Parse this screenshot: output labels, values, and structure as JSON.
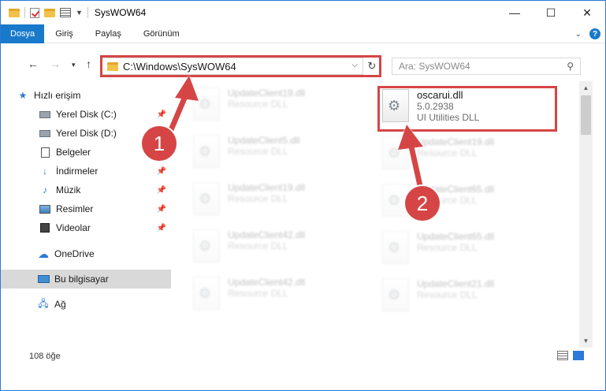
{
  "window": {
    "title": "SysWOW64",
    "controls": {
      "minimize": "—",
      "maximize": "☐",
      "close": "✕"
    }
  },
  "ribbon": {
    "tabs": [
      "Dosya",
      "Giriş",
      "Paylaş",
      "Görünüm"
    ],
    "active_tab": "Dosya"
  },
  "nav": {
    "address": "C:\\Windows\\SysWOW64",
    "search_placeholder": "Ara: SysWOW64"
  },
  "sidebar": {
    "items": [
      {
        "label": "Hızlı erişim",
        "icon": "star-icon",
        "pinned": false
      },
      {
        "label": "Yerel Disk (C:)",
        "icon": "drive-icon",
        "pinned": true
      },
      {
        "label": "Yerel Disk (D:)",
        "icon": "drive-icon",
        "pinned": false
      },
      {
        "label": "Belgeler",
        "icon": "documents-icon",
        "pinned": false
      },
      {
        "label": "İndirmeler",
        "icon": "download-icon",
        "pinned": true
      },
      {
        "label": "Müzik",
        "icon": "music-icon",
        "pinned": true
      },
      {
        "label": "Resimler",
        "icon": "pictures-icon",
        "pinned": true
      },
      {
        "label": "Videolar",
        "icon": "video-icon",
        "pinned": true
      },
      {
        "label": "OneDrive",
        "icon": "cloud-icon",
        "pinned": false
      },
      {
        "label": "Bu bilgisayar",
        "icon": "computer-icon",
        "pinned": false,
        "selected": true
      },
      {
        "label": "Ağ",
        "icon": "network-icon",
        "pinned": false
      }
    ]
  },
  "files": {
    "focus": {
      "name": "oscarui.dll",
      "version": "5.0.2938",
      "description": "UI Utilities DLL"
    },
    "others": [
      {
        "name": "UpdateClient19.dll",
        "description": "Resource DLL"
      },
      {
        "name": "UpdateClient5.dll",
        "description": "Resource DLL"
      },
      {
        "name": "UpdateClient19.dll",
        "description": "Resource DLL"
      },
      {
        "name": "UpdateClient19.dll",
        "description": "Resource DLL"
      },
      {
        "name": "UpdateClient65.dll",
        "description": "Resource DLL"
      },
      {
        "name": "UpdateClient42.dll",
        "description": "Resource DLL"
      },
      {
        "name": "UpdateClient65.dll",
        "description": "Resource DLL"
      },
      {
        "name": "UpdateClient42.dll",
        "description": "Resource DLL"
      },
      {
        "name": "UpdateClient21.dll",
        "description": "Resource DLL"
      }
    ]
  },
  "status": {
    "count": "108 öğe"
  },
  "annotations": {
    "step1": "1",
    "step2": "2",
    "color": "#d64545"
  }
}
